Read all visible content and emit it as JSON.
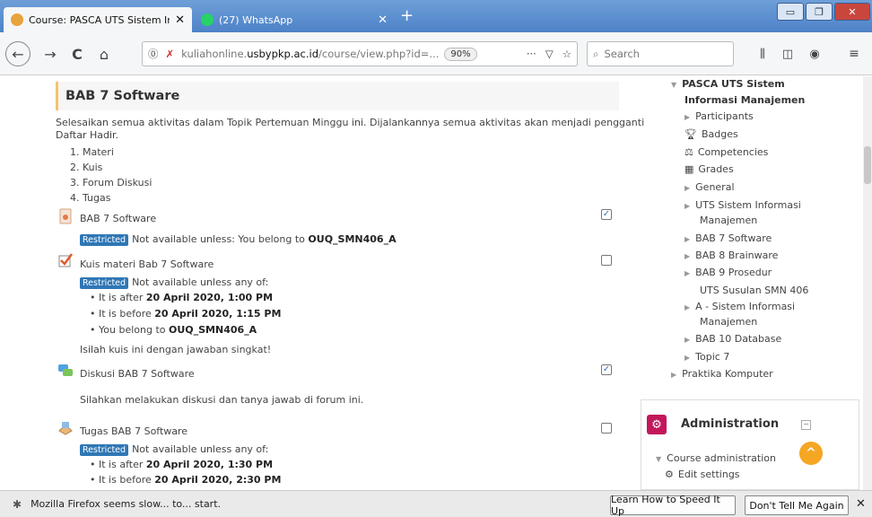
{
  "tabs": [
    {
      "title": "Course: PASCA UTS Sistem Info",
      "close": "✕"
    },
    {
      "title": "(27) WhatsApp",
      "close": "✕"
    }
  ],
  "new_tab": "+",
  "window_buttons": {
    "minimize": "▭",
    "maximize": "❐",
    "close": "✕"
  },
  "nav": {
    "back": "←",
    "forward": "→",
    "reload": "C",
    "home": "⌂",
    "url_prefix": "kuliahonline.",
    "url_domain": "usbypkp.ac.id",
    "url_path": "/course/view.php?id=...",
    "zoom": "90%",
    "more": "···",
    "search_placeholder": "Search"
  },
  "section": {
    "title": "BAB 7 Software",
    "intro": "Selesaikan semua aktivitas dalam Topik Pertemuan Minggu ini. Dijalankannya semua aktivitas akan menjadi pengganti",
    "intro2": "Daftar Hadir.",
    "list": [
      "1. Materi",
      "2. Kuis",
      "3. Forum Diskusi",
      "4. Tugas"
    ],
    "activities": [
      {
        "name": "BAB 7 Software",
        "badge": "Restricted",
        "restr": "Not available unless: You belong to",
        "restr_bold": "OUQ_SMN406_A",
        "checked": true
      },
      {
        "name": "Kuis materi Bab 7 Software",
        "badge": "Restricted",
        "restr": "Not available unless any of:",
        "bullets": [
          {
            "pre": "It is after",
            "bold": "20 April 2020, 1:00 PM"
          },
          {
            "pre": "It is before",
            "bold": "20 April 2020, 1:15 PM"
          },
          {
            "pre": "You belong to",
            "bold": "OUQ_SMN406_A"
          }
        ],
        "desc": "Isilah kuis ini dengan jawaban singkat!",
        "checked": false
      },
      {
        "name": "Diskusi BAB 7 Software",
        "desc": "Silahkan melakukan diskusi dan tanya jawab di forum ini.",
        "checked": true
      },
      {
        "name": "Tugas BAB 7 Software",
        "badge": "Restricted",
        "restr": "Not available unless any of:",
        "bullets": [
          {
            "pre": "It is after",
            "bold": "20 April 2020, 1:30 PM"
          },
          {
            "pre": "It is before",
            "bold": "20 April 2020, 2:30 PM"
          }
        ],
        "checked": false
      }
    ]
  },
  "sidebar": {
    "course_line1": "PASCA UTS Sistem",
    "course_line2": "Informasi Manajemen",
    "items": [
      "Participants",
      "Badges",
      "Competencies",
      "Grades",
      "General"
    ],
    "uts_line1": "UTS Sistem Informasi",
    "uts_line2": "Manajemen",
    "items2": [
      "BAB 7 Software",
      "BAB 8 Brainware",
      "BAB 9 Prosedur"
    ],
    "susulan": "UTS Susulan SMN 406",
    "a_line1": "A - Sistem Informasi",
    "a_line2": "Manajemen",
    "items3": [
      "BAB 10 Database",
      "Topic 7",
      "Praktika Komputer"
    ],
    "admin_title": "Administration",
    "course_admin": "Course administration",
    "edit_settings": "Edit settings"
  },
  "notification": {
    "text": "Mozilla Firefox seems slow... to... start.",
    "btn1": "Learn How to Speed It Up",
    "btn2": "Don't Tell Me Again",
    "close": "✕"
  },
  "colors": {
    "accent": "#2f77b5",
    "tabbar": "#5a8ecf",
    "admin_icon": "#c2185b",
    "scroll_top": "#f5a623"
  }
}
